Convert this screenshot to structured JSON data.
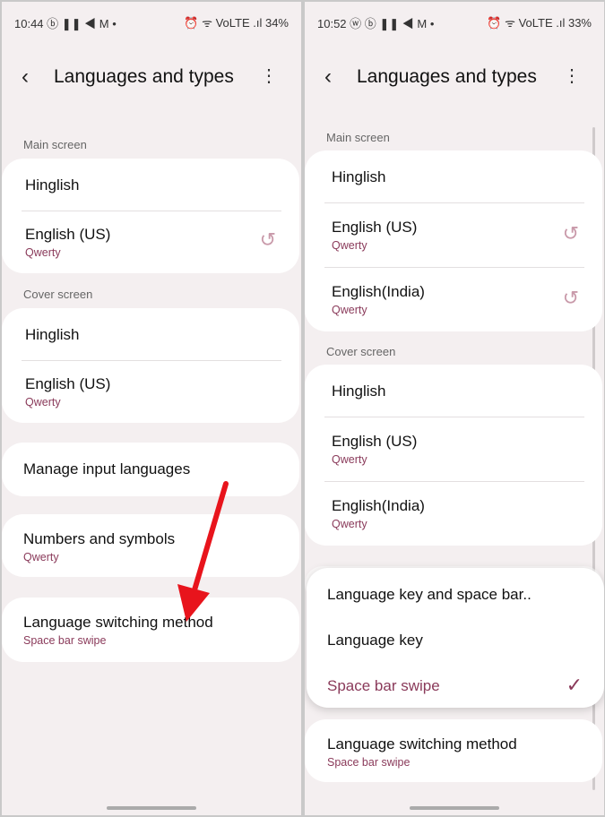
{
  "left": {
    "status": {
      "time": "10:44",
      "icons": "ⓑ ❚❚ ◀ M •",
      "right": "⏰ ᯤ VoLTE .ıl 34%"
    },
    "header": {
      "title": "Languages and types"
    },
    "main_screen": {
      "label": "Main screen",
      "items": [
        {
          "title": "Hinglish"
        },
        {
          "title": "English (US)",
          "sub": "Qwerty"
        }
      ]
    },
    "cover_screen": {
      "label": "Cover screen",
      "items": [
        {
          "title": "Hinglish"
        },
        {
          "title": "English (US)",
          "sub": "Qwerty"
        }
      ]
    },
    "manage": {
      "title": "Manage input languages"
    },
    "numbers": {
      "title": "Numbers and symbols",
      "sub": "Qwerty"
    },
    "switching": {
      "title": "Language switching method",
      "sub": "Space bar swipe"
    },
    "annotation_color": "#e8141c"
  },
  "right": {
    "status": {
      "time": "10:52",
      "icons": "ⓦ ⓑ ❚❚ ◀ M •",
      "right": "⏰ ᯤ VoLTE .ıl 33%"
    },
    "header": {
      "title": "Languages and types"
    },
    "main_screen": {
      "label": "Main screen",
      "items": [
        {
          "title": "Hinglish"
        },
        {
          "title": "English (US)",
          "sub": "Qwerty"
        },
        {
          "title": "English(India)",
          "sub": "Qwerty"
        }
      ]
    },
    "cover_screen": {
      "label": "Cover screen",
      "items": [
        {
          "title": "Hinglish"
        },
        {
          "title": "English (US)",
          "sub": "Qwerty"
        },
        {
          "title": "English(India)",
          "sub": "Qwerty"
        }
      ]
    },
    "popup": {
      "options": [
        "Language key and space bar..",
        "Language key",
        "Space bar swipe"
      ],
      "selected": "Space bar swipe"
    },
    "switching": {
      "title": "Language switching method",
      "sub": "Space bar swipe"
    }
  },
  "accent": "#8a3a5a"
}
